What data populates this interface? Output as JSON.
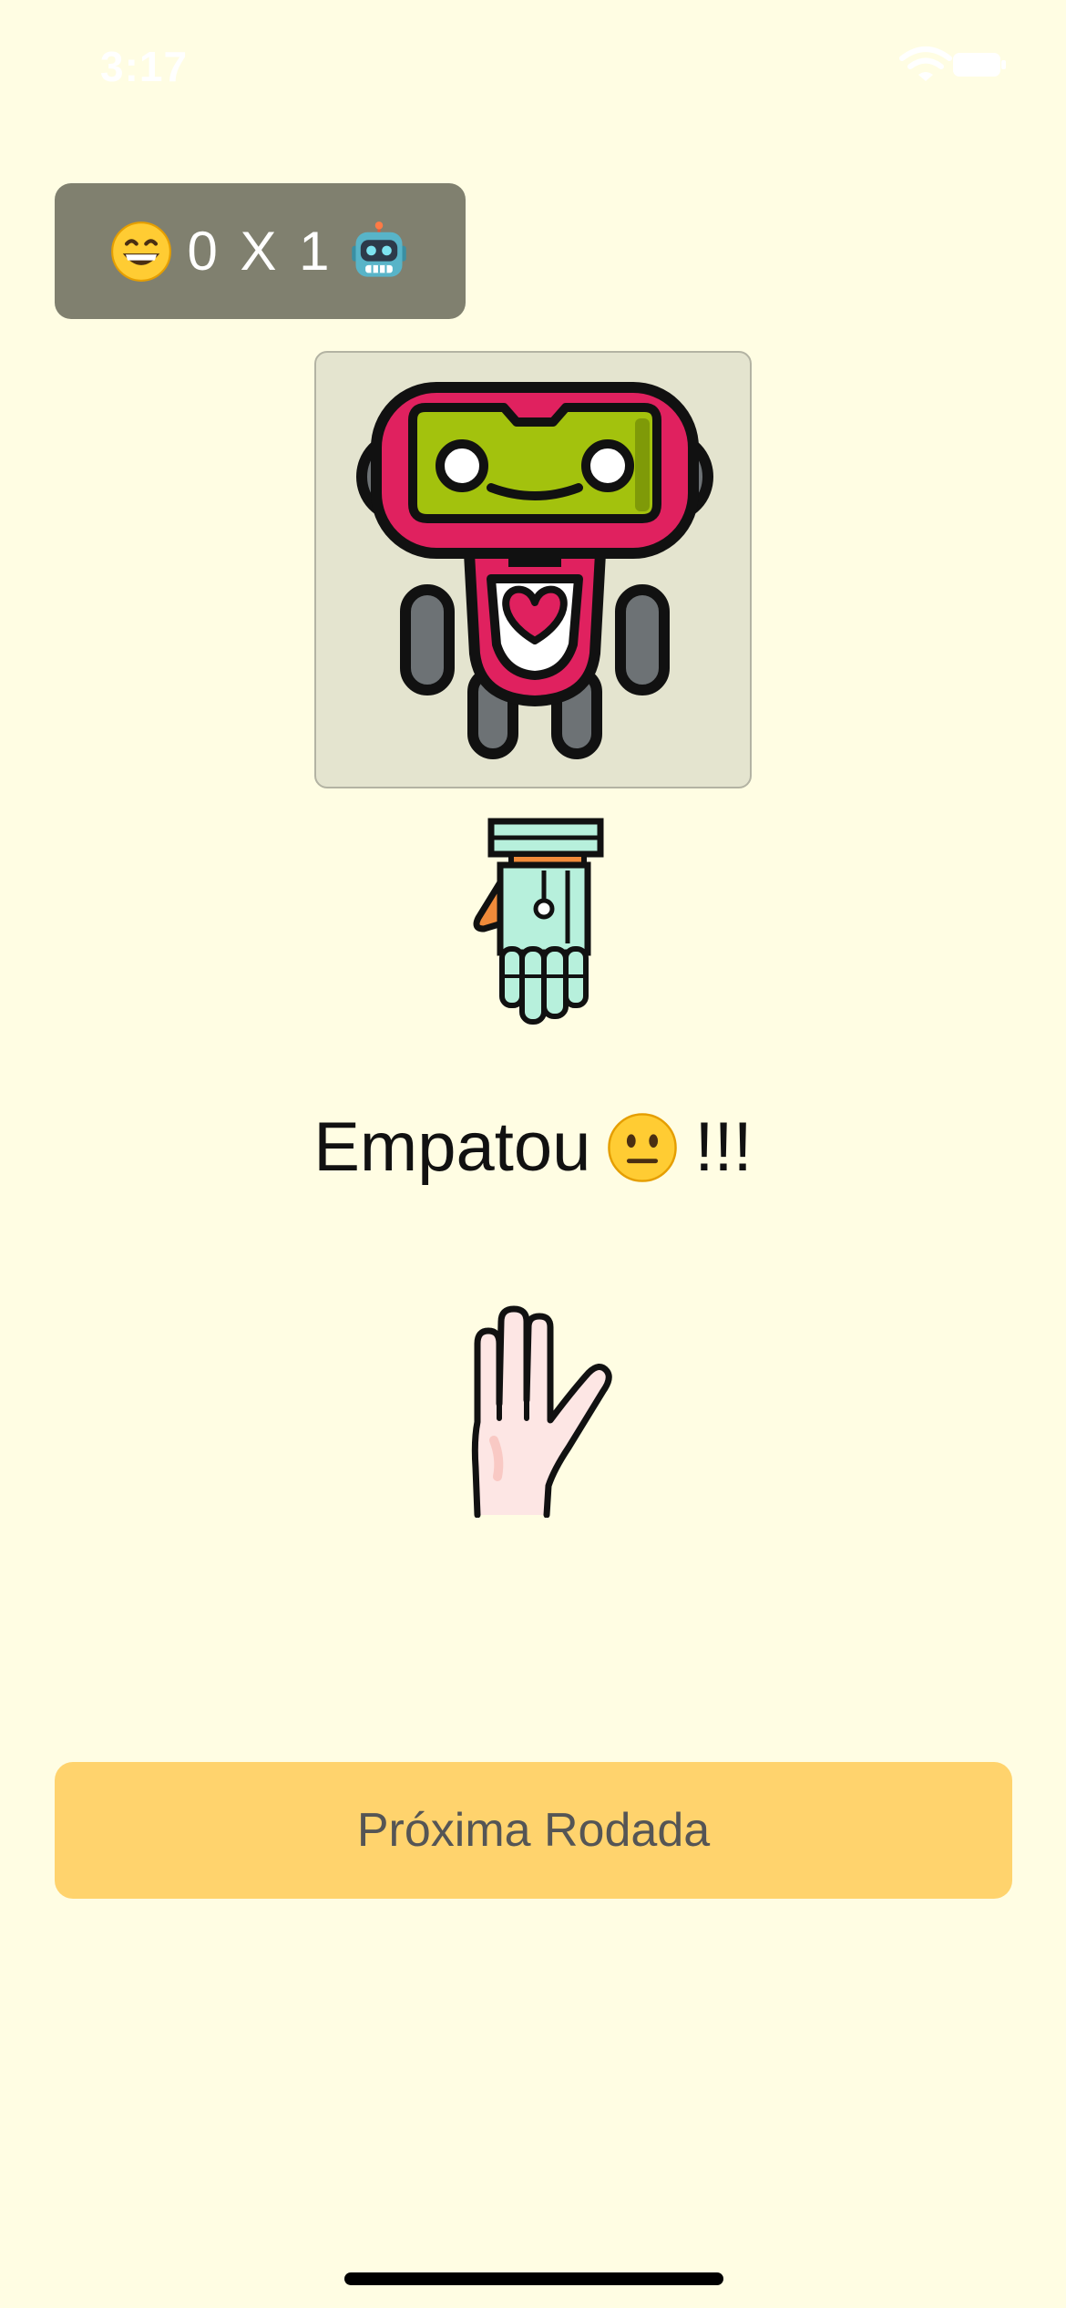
{
  "status_bar": {
    "time": "3:17",
    "icons": [
      "wifi-icon",
      "battery-icon"
    ]
  },
  "scoreboard": {
    "player_emoji": "grinning-face-icon",
    "score_text": "0 X 1",
    "robot_emoji": "robot-face-icon"
  },
  "robot_card": {
    "image": "robot-avatar"
  },
  "robot_choice": {
    "icon": "robot-hand-paper-icon"
  },
  "result": {
    "text_before": "Empatou",
    "emoji": "neutral-face-icon",
    "text_after": "!!!"
  },
  "player_choice": {
    "icon": "hand-paper-icon"
  },
  "next_button": {
    "label": "Próxima Rodada"
  },
  "colors": {
    "background": "#fffde3",
    "scoreboard_bg": "#80806f",
    "card_bg": "#e4e4cf",
    "button_bg": "#ffd36d",
    "robot_magenta": "#e0215f",
    "robot_green": "#a3c20d"
  }
}
